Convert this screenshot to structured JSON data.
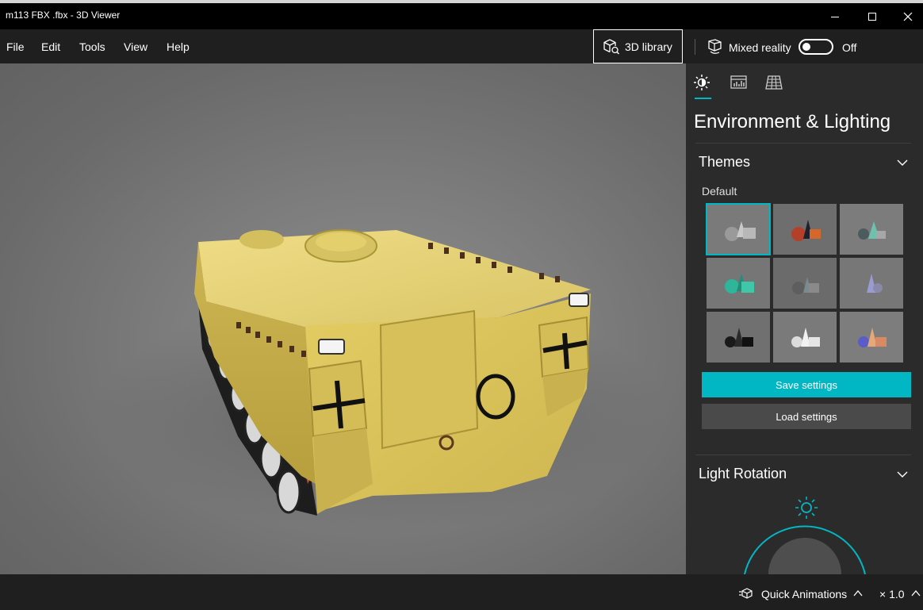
{
  "window": {
    "title": "m113 FBX .fbx - 3D Viewer",
    "controls": [
      "minimize",
      "maximize",
      "close"
    ]
  },
  "menu": {
    "items": [
      "File",
      "Edit",
      "Tools",
      "View",
      "Help"
    ],
    "library_button": "3D library",
    "mixed_reality_label": "Mixed reality",
    "mixed_reality_state": "Off"
  },
  "panel": {
    "tabs": [
      {
        "name": "environment-lighting",
        "icon": "sun-icon",
        "active": true
      },
      {
        "name": "stats-shading",
        "icon": "stats-icon",
        "active": false
      },
      {
        "name": "grid-views",
        "icon": "grid-icon",
        "active": false
      }
    ],
    "title": "Environment & Lighting",
    "themes": {
      "heading": "Themes",
      "current": "Default",
      "selected_index": 0,
      "count": 9
    },
    "save_button": "Save settings",
    "load_button": "Load settings",
    "light_rotation": {
      "heading": "Light Rotation"
    }
  },
  "statusbar": {
    "quick_animations": "Quick Animations",
    "speed": "× 1.0"
  },
  "colors": {
    "accent": "#00b7c3",
    "model": "#e0c75c",
    "panel_bg": "#2b2b2b",
    "app_bg": "#1f1f1f"
  }
}
